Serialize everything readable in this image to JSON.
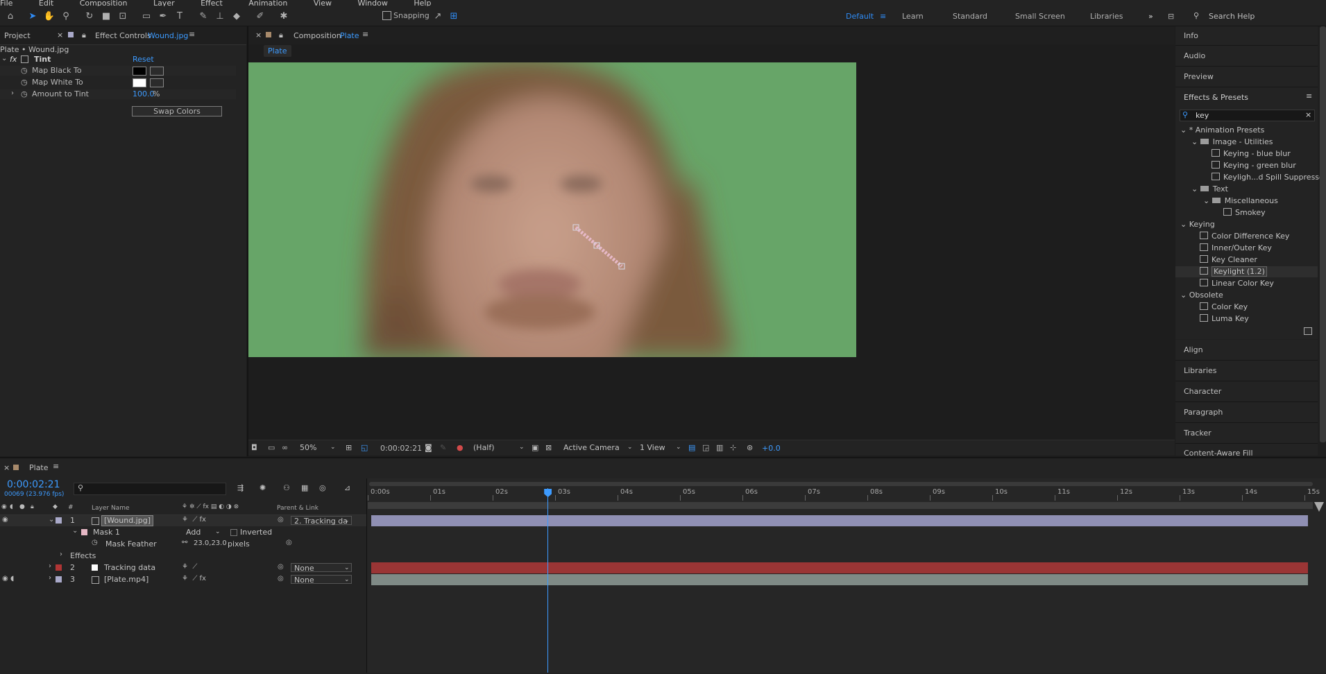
{
  "menu": {
    "items": [
      "File",
      "Edit",
      "Composition",
      "Layer",
      "Effect",
      "Animation",
      "View",
      "Window",
      "Help"
    ]
  },
  "toolbar": {
    "snapping_label": "Snapping",
    "workspaces": [
      "Default",
      "Learn",
      "Standard",
      "Small Screen",
      "Libraries"
    ],
    "active_workspace": "Default",
    "search_placeholder": "Search Help"
  },
  "left_panel": {
    "tab_project": "Project",
    "tab_effect_controls": "Effect Controls",
    "tab_effect_controls_target": "Wound.jpg",
    "breadcrumb": "Plate • Wound.jpg",
    "effect": {
      "fx": "fx",
      "name": "Tint",
      "reset": "Reset",
      "map_black": "Map Black To",
      "map_white": "Map White To",
      "amount_label": "Amount to Tint",
      "amount_value": "100.0",
      "amount_unit": "%",
      "swap_button": "Swap Colors",
      "colors": {
        "black": "#000000",
        "white": "#ffffff"
      }
    }
  },
  "composition": {
    "tab_prefix": "Composition",
    "tab_name": "Plate",
    "subtab": "Plate",
    "zoom": "50%",
    "timecode": "0:00:02:21",
    "resolution": "(Half)",
    "camera": "Active Camera",
    "view": "1 View",
    "exposure": "+0.0",
    "bg_color": "#67a568"
  },
  "right_panel": {
    "info": "Info",
    "audio": "Audio",
    "preview": "Preview",
    "effects_presets": "Effects & Presets",
    "search_value": "key",
    "tree": [
      {
        "label": "* Animation Presets",
        "type": "group"
      },
      {
        "label": "Image - Utilities",
        "type": "folder"
      },
      {
        "label": "Keying - blue blur",
        "type": "preset"
      },
      {
        "label": "Keying - green blur",
        "type": "preset"
      },
      {
        "label": "Keyligh...d Spill Suppressor",
        "type": "preset"
      },
      {
        "label": "Text",
        "type": "folder"
      },
      {
        "label": "Miscellaneous",
        "type": "folder"
      },
      {
        "label": "Smokey",
        "type": "preset"
      },
      {
        "label": "Keying",
        "type": "group"
      },
      {
        "label": "Color Difference Key",
        "type": "effect"
      },
      {
        "label": "Inner/Outer Key",
        "type": "effect"
      },
      {
        "label": "Key Cleaner",
        "type": "effect"
      },
      {
        "label": "Keylight (1.2)",
        "type": "effect",
        "selected": true
      },
      {
        "label": "Linear Color Key",
        "type": "effect"
      },
      {
        "label": "Obsolete",
        "type": "group"
      },
      {
        "label": "Color Key",
        "type": "effect"
      },
      {
        "label": "Luma Key",
        "type": "effect"
      }
    ],
    "lower": [
      "Align",
      "Libraries",
      "Character",
      "Paragraph",
      "Tracker",
      "Content-Aware Fill"
    ]
  },
  "timeline": {
    "tab": "Plate",
    "timecode": "0:00:02:21",
    "frame_info": "00069 (23.976 fps)",
    "col_layer_name": "Layer Name",
    "col_parent": "Parent & Link",
    "ruler": [
      "0:00s",
      "01s",
      "02s",
      "03s",
      "04s",
      "05s",
      "06s",
      "07s",
      "08s",
      "09s",
      "10s",
      "11s",
      "12s",
      "13s",
      "14s",
      "15s"
    ],
    "layers": [
      {
        "num": "1",
        "name": "[Wound.jpg]",
        "parent": "2. Tracking da",
        "color": "#a9a9c9"
      },
      {
        "num": "2",
        "name": "Tracking data",
        "parent": "None",
        "color": "#b03535"
      },
      {
        "num": "3",
        "name": "[Plate.mp4]",
        "parent": "None",
        "color": "#a9a9c9"
      }
    ],
    "mask": {
      "name": "Mask 1",
      "mode": "Add",
      "inverted": "Inverted",
      "feather_label": "Mask Feather",
      "feather_value": "23.0,23.0",
      "feather_unit": "pixels"
    },
    "effects_label": "Effects",
    "playhead_seconds": 2.88
  }
}
